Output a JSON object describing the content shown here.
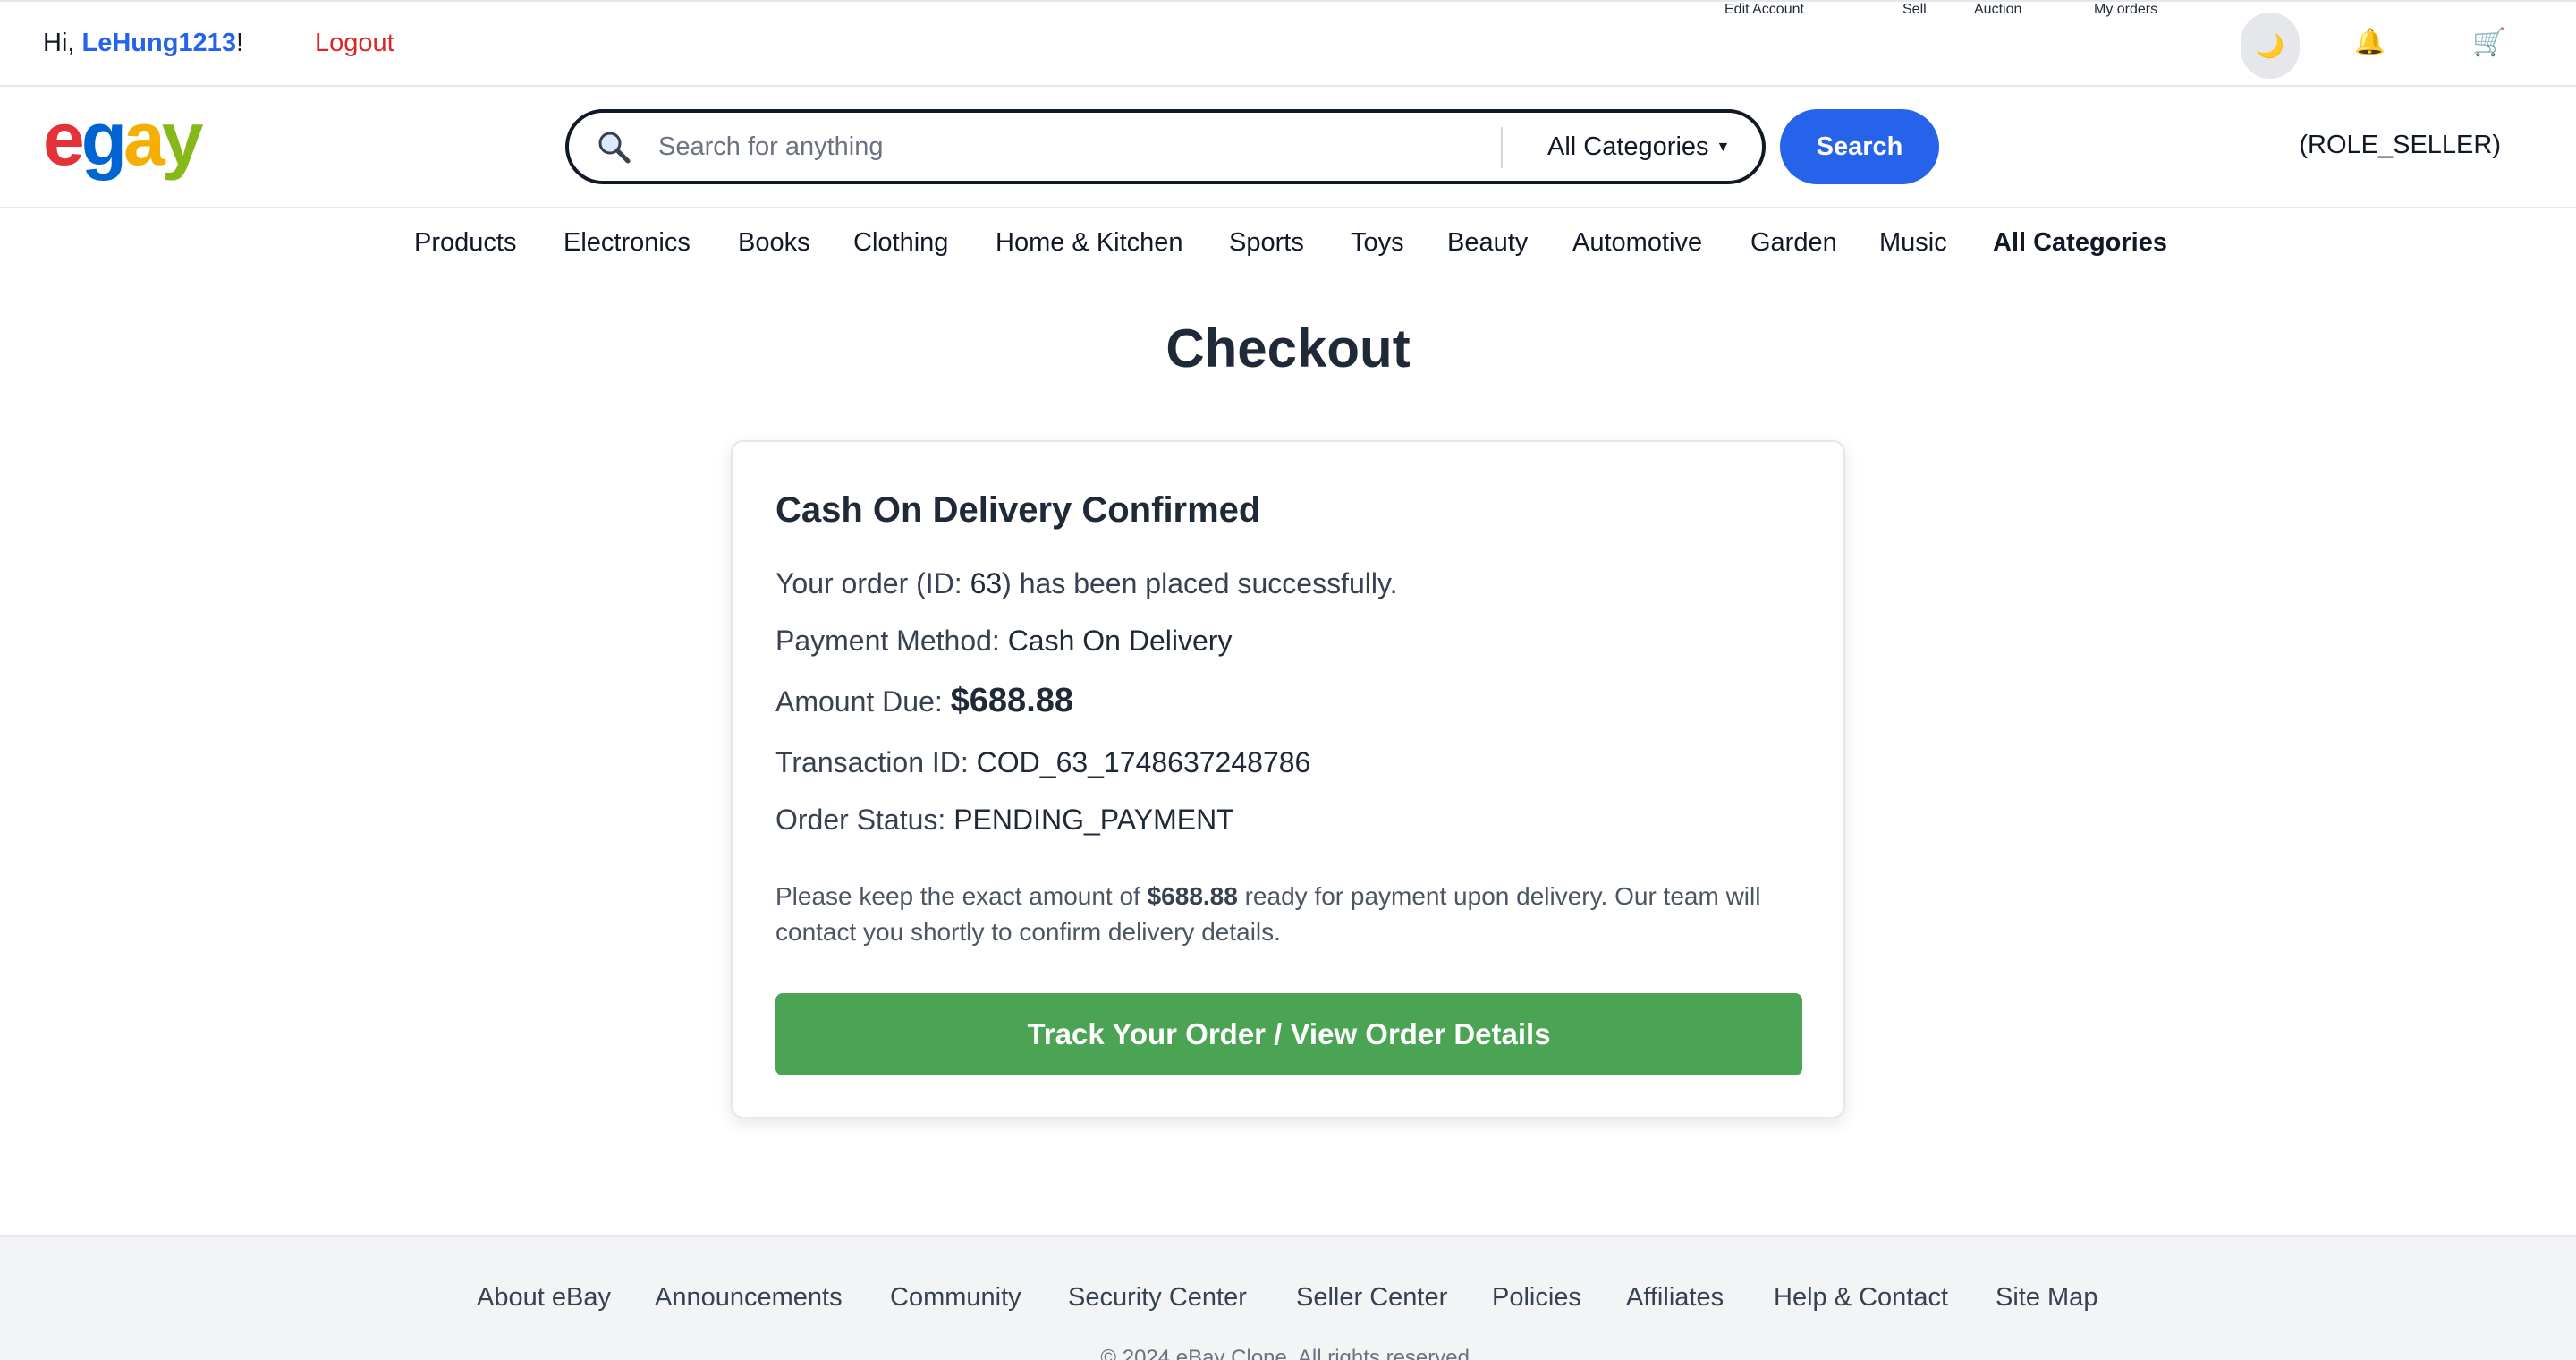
{
  "topbar": {
    "greeting_prefix": "Hi, ",
    "username": "LeHung1213",
    "greeting_suffix": "!",
    "logout": "Logout",
    "links": [
      "Edit Account",
      "Sell",
      "Auction",
      "My orders"
    ],
    "theme_icon": "🌙",
    "bell_icon": "🔔",
    "cart_icon": "🛒"
  },
  "header": {
    "logo": {
      "e": "e",
      "g": "g",
      "a": "a",
      "y": "y"
    },
    "search_placeholder": "Search for anything",
    "category_selected": "All Categories",
    "search_button": "Search",
    "role": "(ROLE_SELLER)"
  },
  "categories": [
    "Products",
    "Electronics",
    "Books",
    "Clothing",
    "Home & Kitchen",
    "Sports",
    "Toys",
    "Beauty",
    "Automotive",
    "Garden",
    "Music",
    "All Categories"
  ],
  "main": {
    "title": "Checkout",
    "card": {
      "heading": "Cash On Delivery Confirmed",
      "order_prefix": "Your order (ID: ",
      "order_id": "63",
      "order_suffix": ") has been placed successfully.",
      "payment_label": "Payment Method: ",
      "payment_value": "Cash On Delivery",
      "amount_label": "Amount Due: ",
      "amount_value": "$688.88",
      "txn_label": "Transaction ID: ",
      "txn_value": "COD_63_1748637248786",
      "status_label": "Order Status: ",
      "status_value": "PENDING_PAYMENT",
      "note_prefix": "Please keep the exact amount of ",
      "note_amount": "$688.88",
      "note_suffix": " ready for payment upon delivery. Our team will contact you shortly to confirm delivery details.",
      "track_button": "Track Your Order / View Order Details"
    }
  },
  "footer": {
    "links": [
      "About eBay",
      "Announcements",
      "Community",
      "Security Center",
      "Seller Center",
      "Policies",
      "Affiliates",
      "Help & Contact",
      "Site Map"
    ],
    "copyright": "© 2024 eBay Clone. All rights reserved."
  },
  "colors": {
    "accent": "#2563eb",
    "logout": "#dc2626",
    "success_button": "#4ba354"
  }
}
